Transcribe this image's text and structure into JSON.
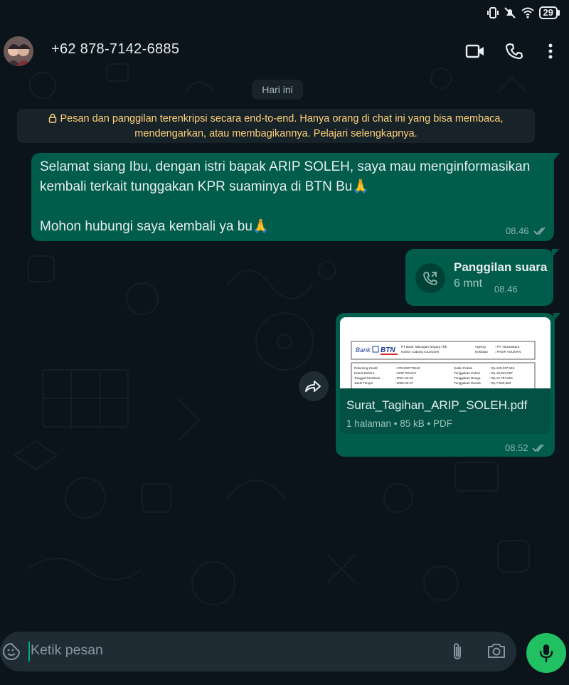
{
  "status_bar": {
    "battery": "29"
  },
  "header": {
    "contact_name": "+62 878-7142-6885"
  },
  "chat": {
    "date_label": "Hari ini",
    "encryption_notice": "Pesan dan panggilan terenkripsi secara end-to-end. Hanya orang di chat ini yang bisa membaca, mendengarkan, atau membagikannya. Pelajari selengkapnya.",
    "messages": [
      {
        "text": "Selamat siang Ibu, dengan istri bapak ARIP SOLEH, saya mau menginformasikan kembali terkait tunggakan KPR suaminya di BTN Bu🙏\n\nMohon hubungi saya kembali ya bu🙏",
        "time": "08.46"
      },
      {
        "call_title": "Panggilan suara",
        "call_duration": "6 mnt",
        "time": "08.46"
      },
      {
        "doc_name": "Surat_Tagihan_ARIP_SOLEH.pdf",
        "doc_meta": "1 halaman  •  85 kB  •  PDF",
        "time": "08.52",
        "preview": {
          "logo_bank": "Bank",
          "logo_btn": "BTN",
          "header_left": [
            "PT Bank Tabungan Negara Tbk",
            "Kantor Cabang CILEGON"
          ],
          "header_right_labels": [
            "Agency",
            "Kelolaan"
          ],
          "header_right_values": [
            ": PT. Noesantara",
            ": PASIF AGUNAN"
          ],
          "rows_left_labels": [
            "Rekening Kredit",
            "Nama Debitur",
            "Tanggal Realisasi",
            "Jatuh Tempo"
          ],
          "rows_left_values": [
            ": 4701020775160",
            ": ARIP SOLEH",
            ": 2021-03-30",
            ": 2005-03-07"
          ],
          "rows_right_labels": [
            "Saldo Pokok",
            "Tunggakan Pokok",
            "Tunggakan Bunga",
            "Tunggakan Denda"
          ],
          "rows_right_values": [
            ": Rp.120,337,346",
            ": Rp.19,922,087",
            ": Rp.14,787,660",
            ": Rp.7,502,860"
          ]
        }
      }
    ]
  },
  "input": {
    "placeholder": "Ketik pesan"
  },
  "colors": {
    "outgoing_bubble": "#005c4b",
    "background": "#0b141a",
    "accent": "#21c063",
    "notice_text": "#ffd279"
  }
}
